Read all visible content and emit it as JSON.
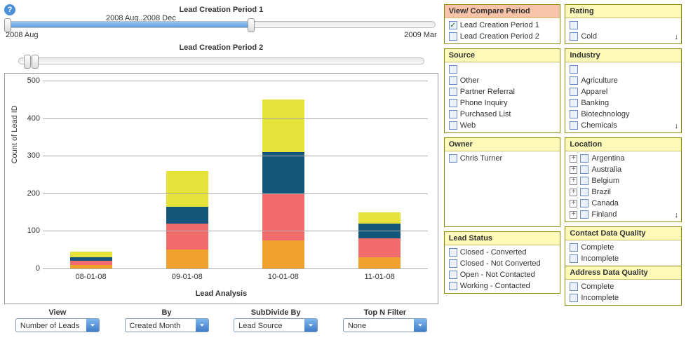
{
  "help_icon_glyph": "?",
  "slider1": {
    "title": "Lead Creation Period 1",
    "range_label": "2008 Aug..2008 Dec",
    "start_label": "2008 Aug",
    "end_label": "2009 Mar",
    "fill_left_pct": 0,
    "fill_width_pct": 57,
    "handle_a_pct": 0,
    "handle_b_pct": 57
  },
  "slider2": {
    "title": "Lead Creation Period 2",
    "handle_a_pct": 2,
    "handle_b_pct": 4
  },
  "chart_yaxis_label": "Count of Lead ID",
  "xaxis_title": "Lead Analysis",
  "chart_data": {
    "type": "bar",
    "stacked": true,
    "title": "",
    "xlabel": "Lead Analysis",
    "ylabel": "Count of Lead ID",
    "ylim": [
      0,
      500
    ],
    "yticks": [
      0,
      100,
      200,
      300,
      400,
      500
    ],
    "categories": [
      "08-01-08",
      "09-01-08",
      "10-01-08",
      "11-01-08"
    ],
    "series": [
      {
        "name": "yellow",
        "color": "#e5e239",
        "values": [
          15,
          95,
          140,
          30
        ]
      },
      {
        "name": "blue",
        "color": "#15577a",
        "values": [
          10,
          45,
          110,
          40
        ]
      },
      {
        "name": "red",
        "color": "#f16b6b",
        "values": [
          10,
          70,
          125,
          50
        ]
      },
      {
        "name": "orange",
        "color": "#f0a22e",
        "values": [
          10,
          50,
          75,
          30
        ]
      }
    ]
  },
  "controls": {
    "view": {
      "label": "View",
      "value": "Number of Leads"
    },
    "by": {
      "label": "By",
      "value": "Created Month"
    },
    "subdivide_by": {
      "label": "SubDivide By",
      "value": "Lead Source"
    },
    "top_n": {
      "label": "Top N Filter",
      "value": "None"
    }
  },
  "panels": {
    "view_compare": {
      "title": "View/ Compare Period",
      "options": [
        {
          "label": "Lead Creation Period 1",
          "checked": true
        },
        {
          "label": "Lead Creation Period 2",
          "checked": false
        }
      ]
    },
    "rating": {
      "title": "Rating",
      "options": [
        {
          "label": "",
          "checked": false
        },
        {
          "label": "Cold",
          "checked": false
        }
      ],
      "scroll_more": true
    },
    "source": {
      "title": "Source",
      "options": [
        {
          "label": "",
          "checked": false
        },
        {
          "label": "Other",
          "checked": false
        },
        {
          "label": "Partner Referral",
          "checked": false
        },
        {
          "label": "Phone Inquiry",
          "checked": false
        },
        {
          "label": "Purchased List",
          "checked": false
        },
        {
          "label": "Web",
          "checked": false
        }
      ]
    },
    "industry": {
      "title": "Industry",
      "options": [
        {
          "label": "",
          "checked": false
        },
        {
          "label": "Agriculture",
          "checked": false
        },
        {
          "label": "Apparel",
          "checked": false
        },
        {
          "label": "Banking",
          "checked": false
        },
        {
          "label": "Biotechnology",
          "checked": false
        },
        {
          "label": "Chemicals",
          "checked": false
        }
      ],
      "scroll_more": true
    },
    "owner": {
      "title": "Owner",
      "options": [
        {
          "label": "Chris Turner",
          "checked": false
        }
      ]
    },
    "location": {
      "title": "Location",
      "options": [
        {
          "label": "Argentina",
          "checked": false,
          "expandable": true
        },
        {
          "label": "Australia",
          "checked": false,
          "expandable": true
        },
        {
          "label": "Belgium",
          "checked": false,
          "expandable": true
        },
        {
          "label": "Brazil",
          "checked": false,
          "expandable": true
        },
        {
          "label": "Canada",
          "checked": false,
          "expandable": true
        },
        {
          "label": "Finland",
          "checked": false,
          "expandable": true
        }
      ],
      "scroll_more": true
    },
    "lead_status": {
      "title": "Lead Status",
      "options": [
        {
          "label": "Closed - Converted",
          "checked": false
        },
        {
          "label": "Closed - Not Converted",
          "checked": false
        },
        {
          "label": "Open - Not Contacted",
          "checked": false
        },
        {
          "label": "Working - Contacted",
          "checked": false
        }
      ]
    },
    "contact_dq": {
      "title": "Contact Data Quality",
      "options": [
        {
          "label": "Complete",
          "checked": false
        },
        {
          "label": "Incomplete",
          "checked": false
        }
      ]
    },
    "address_dq": {
      "title": "Address Data Quality",
      "options": [
        {
          "label": "Complete",
          "checked": false
        },
        {
          "label": "Incomplete",
          "checked": false
        }
      ]
    }
  }
}
